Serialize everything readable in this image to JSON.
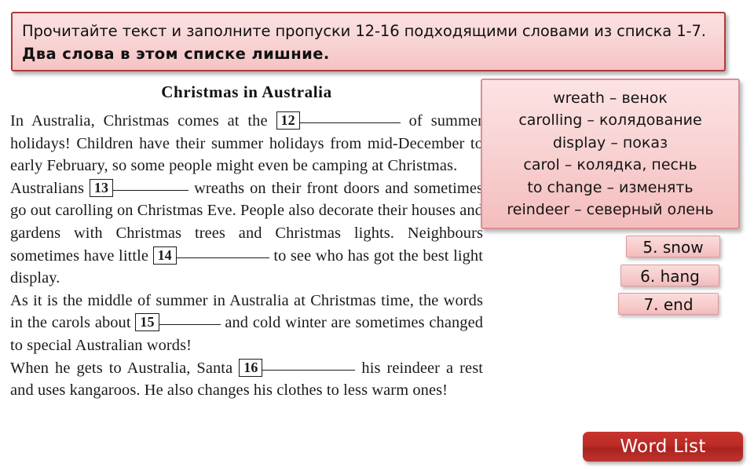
{
  "banner": {
    "line1": "Прочитайте текст и заполните пропуски 12-16 подходящими словами из списка 1-7.",
    "line2": "Два слова в этом списке лишние."
  },
  "passage": {
    "title": "Christmas in Australia",
    "paragraphs": [
      {
        "id": "para-1",
        "segments": [
          {
            "type": "text",
            "value": "In Australia, Christmas comes at the "
          },
          {
            "type": "blank",
            "number": "12"
          },
          {
            "type": "text",
            "value": " of summer holidays! Children have their summer holidays from mid-December to early February, so some people might even be camping at Christmas."
          }
        ]
      },
      {
        "id": "para-2",
        "segments": [
          {
            "type": "text",
            "value": "Australians "
          },
          {
            "type": "blank",
            "number": "13"
          },
          {
            "type": "text",
            "value": " wreaths on their front doors and sometimes go out carolling on Christmas Eve. People also decorate their houses and gardens with Christmas trees and Christmas lights. Neighbours sometimes have little "
          },
          {
            "type": "blank",
            "number": "14"
          },
          {
            "type": "text",
            "value": " to see who has got the best light display."
          }
        ]
      },
      {
        "id": "para-3",
        "segments": [
          {
            "type": "text",
            "value": "As it is the middle of summer in Australia at Christmas time, the words in the carols about "
          },
          {
            "type": "blank",
            "number": "15"
          },
          {
            "type": "text",
            "value": " and cold winter are sometimes changed to special Australian words!"
          }
        ]
      },
      {
        "id": "para-4",
        "segments": [
          {
            "type": "text",
            "value": "When he gets to Australia, Santa "
          },
          {
            "type": "blank",
            "number": "16"
          },
          {
            "type": "text",
            "value": " his reindeer a rest and uses kangaroos. He also changes his clothes to less warm ones!"
          }
        ]
      }
    ],
    "p1_a": "In Australia, Christmas comes at the",
    "p1_b": "of summer holidays! Children have their summer holidays from mid-December to early February, so some people might even be camping at Christmas.",
    "p2_a": "Australians",
    "p2_b": "wreaths on their front doors and sometimes go out carolling on Christmas Eve. People also decorate their houses and gardens with Christmas trees and Christmas lights. Neighbours sometimes have little",
    "p2_c": "to see who has got the best light display.",
    "p3_a": "As it is the middle of summer in Australia at Christmas time, the words in the carols about",
    "p3_b": "and cold winter are sometimes changed to special Australian words!",
    "p4_a": "When he gets to Australia, Santa",
    "p4_b": "his reindeer a rest and uses kangaroos. He also changes his clothes to less warm ones!",
    "blank_12": "12",
    "blank_13": "13",
    "blank_14": "14",
    "blank_15": "15",
    "blank_16": "16"
  },
  "glossary": {
    "entries": [
      "wreath – венок",
      "carolling – колядование",
      "display – показ",
      "carol – колядка, песнь",
      "to change – изменять",
      "reindeer – северный олень"
    ]
  },
  "word_options": [
    {
      "id": "5",
      "label": "5. snow"
    },
    {
      "id": "6",
      "label": "6. hang"
    },
    {
      "id": "7",
      "label": "7. end"
    }
  ],
  "word_list_button": {
    "label": "Word List"
  },
  "colors": {
    "banner_border": "#b03a3a",
    "banner_fill_top": "#fbe0e0",
    "banner_fill_bottom": "#f6c3c3",
    "panel_border": "#d98f96",
    "option_border": "#dd9a9f",
    "word_list_red": "#bc2b26",
    "page_background": "#ffffff",
    "text_black": "#111111"
  }
}
